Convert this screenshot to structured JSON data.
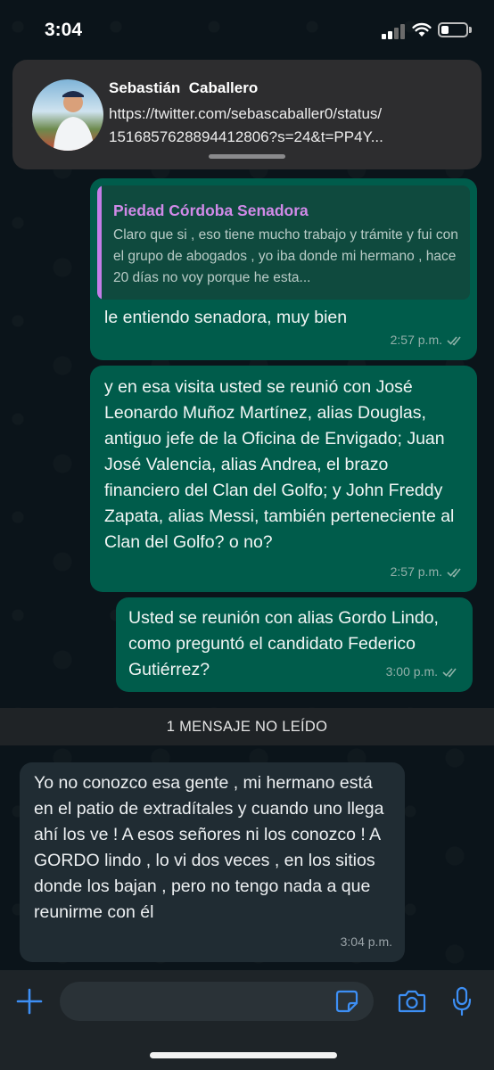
{
  "status_bar": {
    "time": "3:04"
  },
  "notification": {
    "name": "Sebastián  Caballero",
    "url_line1": "https://twitter.com/sebascaballer0/status/",
    "url_line2": "1516857628894412806?s=24&t=PP4Y..."
  },
  "messages": [
    {
      "direction": "outgoing",
      "quote_author": "Piedad Córdoba Senadora",
      "quote_text": "Claro que si , eso tiene mucho trabajo y trámite y fui con el grupo de abogados , yo iba donde mi hermano , hace 20 días no voy porque he esta...",
      "text": "le entiendo senadora, muy bien",
      "time": "2:57 p.m."
    },
    {
      "direction": "outgoing",
      "text": "y en esa visita usted se reunió con José Leonardo Muñoz Martínez, alias Douglas, antiguo jefe de la Oficina de Envigado; Juan José Valencia, alias Andrea, el brazo financiero del Clan del Golfo; y John Freddy Zapata, alias Messi, también perteneciente al Clan del Golfo? o no?",
      "time": "2:57 p.m."
    },
    {
      "direction": "outgoing",
      "text": "Usted se reunión con alias Gordo Lindo, como preguntó el candidato Federico Gutiérrez?",
      "time": "3:00 p.m."
    },
    {
      "direction": "incoming",
      "text": "Yo no conozco esa gente , mi hermano está en el patio de extradítales y cuando uno llega ahí los ve ! A esos señores ni los conozco ! A GORDO lindo ,  lo vi dos veces , en los sitios donde los bajan , pero no tengo nada a que reunirme con él",
      "time": "3:04 p.m."
    }
  ],
  "unread_divider": "1 MENSAJE NO LEÍDO",
  "composer": {
    "placeholder": "",
    "value": ""
  },
  "colors": {
    "outgoing_bubble": "#005c4b",
    "incoming_bubble": "#202c33",
    "accent_blue": "#3d8ff5",
    "quote_author": "#d08ae8"
  },
  "icons": [
    "signal-icon",
    "wifi-icon",
    "battery-icon",
    "add-icon",
    "sticker-icon",
    "camera-icon",
    "microphone-icon",
    "double-check-icon"
  ]
}
